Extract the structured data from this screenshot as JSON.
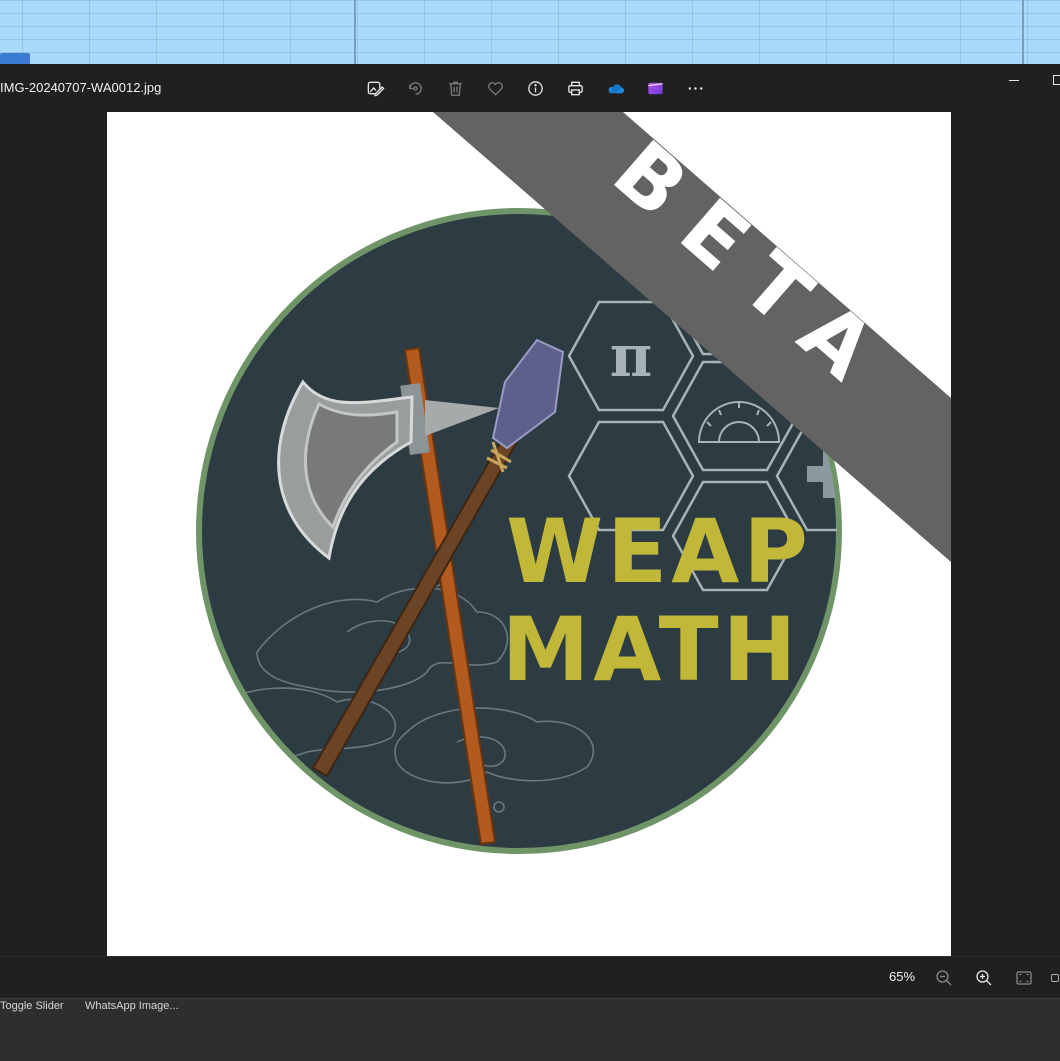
{
  "window": {
    "filename": "IMG-20240707-WA0012.jpg"
  },
  "toolbar": {
    "items": [
      {
        "name": "edit-image-icon",
        "label": "Edit image"
      },
      {
        "name": "rotate-icon",
        "label": "Rotate"
      },
      {
        "name": "delete-icon",
        "label": "Delete"
      },
      {
        "name": "favorite-icon",
        "label": "Add to favorites"
      },
      {
        "name": "info-icon",
        "label": "File information"
      },
      {
        "name": "print-icon",
        "label": "Print"
      },
      {
        "name": "onedrive-icon",
        "label": "OneDrive"
      },
      {
        "name": "clipchamp-icon",
        "label": "Clipchamp"
      },
      {
        "name": "more-icon",
        "label": "See more"
      }
    ]
  },
  "image": {
    "banner": "BETA",
    "logo_line1": "WEAP",
    "logo_line2": "MATH",
    "symbol": "π"
  },
  "statusbar": {
    "zoom": "65%"
  },
  "taskbar": {
    "items": [
      "Toggle Slider",
      "WhatsApp Image..."
    ]
  },
  "colors": {
    "viewer_bg": "#202020",
    "logo_circle": "#2c3c42",
    "logo_border": "#6e9467",
    "logo_text": "#c1b83a",
    "banner": "#636363"
  }
}
